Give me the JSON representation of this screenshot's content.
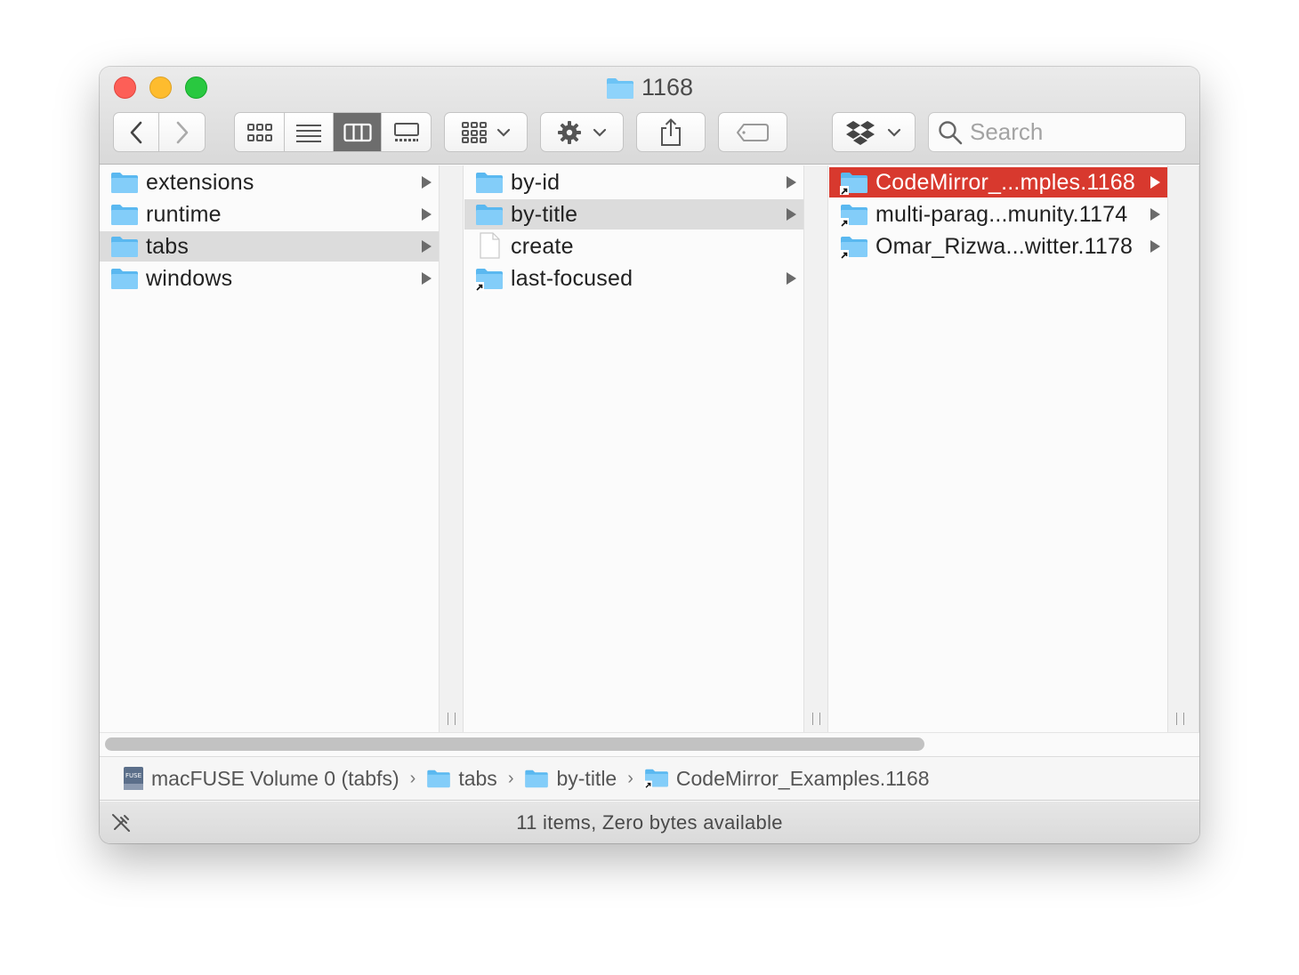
{
  "window": {
    "title": "1168"
  },
  "toolbar": {
    "view_modes": [
      "icon-view",
      "list-view",
      "column-view",
      "gallery-view"
    ],
    "active_view": "column-view",
    "search_placeholder": "Search"
  },
  "columns": [
    {
      "items": [
        {
          "label": "extensions",
          "type": "folder",
          "has_children": true,
          "state": "normal"
        },
        {
          "label": "runtime",
          "type": "folder",
          "has_children": true,
          "state": "normal"
        },
        {
          "label": "tabs",
          "type": "folder",
          "has_children": true,
          "state": "highlighted"
        },
        {
          "label": "windows",
          "type": "folder",
          "has_children": true,
          "state": "normal"
        }
      ]
    },
    {
      "items": [
        {
          "label": "by-id",
          "type": "folder",
          "has_children": true,
          "state": "normal"
        },
        {
          "label": "by-title",
          "type": "folder",
          "has_children": true,
          "state": "highlighted"
        },
        {
          "label": "create",
          "type": "file",
          "has_children": false,
          "state": "normal"
        },
        {
          "label": "last-focused",
          "type": "alias-folder",
          "has_children": true,
          "state": "normal"
        }
      ]
    },
    {
      "items": [
        {
          "label": "CodeMirror_...mples.1168",
          "type": "alias-folder",
          "has_children": true,
          "state": "selected"
        },
        {
          "label": "multi-parag...munity.1174",
          "type": "alias-folder",
          "has_children": true,
          "state": "normal"
        },
        {
          "label": "Omar_Rizwa...witter.1178",
          "type": "alias-folder",
          "has_children": true,
          "state": "normal"
        }
      ]
    }
  ],
  "pathbar": {
    "crumbs": [
      {
        "label": "macFUSE Volume 0 (tabfs)",
        "icon": "drive-icon"
      },
      {
        "label": "tabs",
        "icon": "folder-icon"
      },
      {
        "label": "by-title",
        "icon": "folder-icon"
      },
      {
        "label": "CodeMirror_Examples.1168",
        "icon": "alias-folder-icon"
      }
    ],
    "separator": "›"
  },
  "statusbar": {
    "text": "11 items, Zero bytes available"
  },
  "colors": {
    "selection": "#d8392e",
    "highlight": "#dcdcdc",
    "folder": "#6cc3f5"
  }
}
